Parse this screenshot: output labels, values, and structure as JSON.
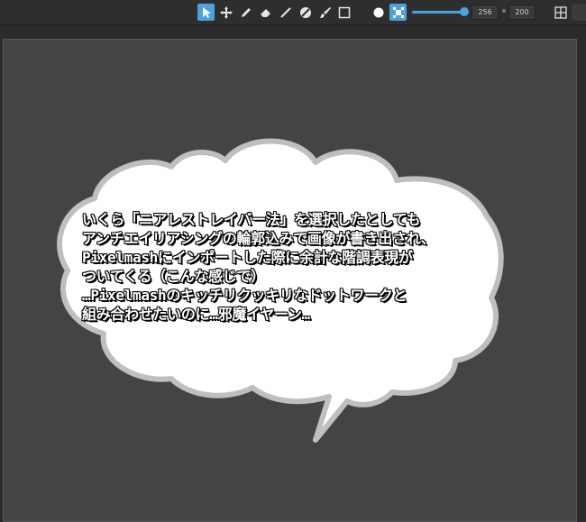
{
  "toolbar": {
    "tools": [
      {
        "name": "select-tool",
        "icon": "arrow-icon",
        "active": true
      },
      {
        "name": "move-tool",
        "icon": "move-icon",
        "active": false
      },
      {
        "name": "pencil-tool",
        "icon": "pencil-icon",
        "active": false
      },
      {
        "name": "eraser-tool",
        "icon": "eraser-icon",
        "active": false
      },
      {
        "name": "line-tool",
        "icon": "line-icon",
        "active": false
      },
      {
        "name": "no-aa-tool",
        "icon": "prohibit-icon",
        "active": false
      },
      {
        "name": "brush-tool",
        "icon": "brush-icon",
        "active": false
      },
      {
        "name": "rect-tool",
        "icon": "square-icon",
        "active": false
      }
    ],
    "circle_brush_icon": "circle-icon",
    "pixel_brush_icon": "pixel-grid-icon",
    "size_slider": {
      "value": 1.0
    },
    "width_value": "256",
    "height_value": "200",
    "grid_icon": "grid-icon"
  },
  "accent_color": "#4aa3df",
  "bubble": {
    "lines": [
      "いくら「ニアレストレイバー法」を選択したとしても",
      "アンチエイリアシングの輪郭込みで画像が書き出され、",
      "Pixelmashにインポートした際に余計な階調表現が",
      "ついてくる（こんな感じで）",
      "…Pixelmashのキッチリクッキリなドットワークと",
      "組み合わせたいのに…邪魔イヤーン…"
    ]
  }
}
